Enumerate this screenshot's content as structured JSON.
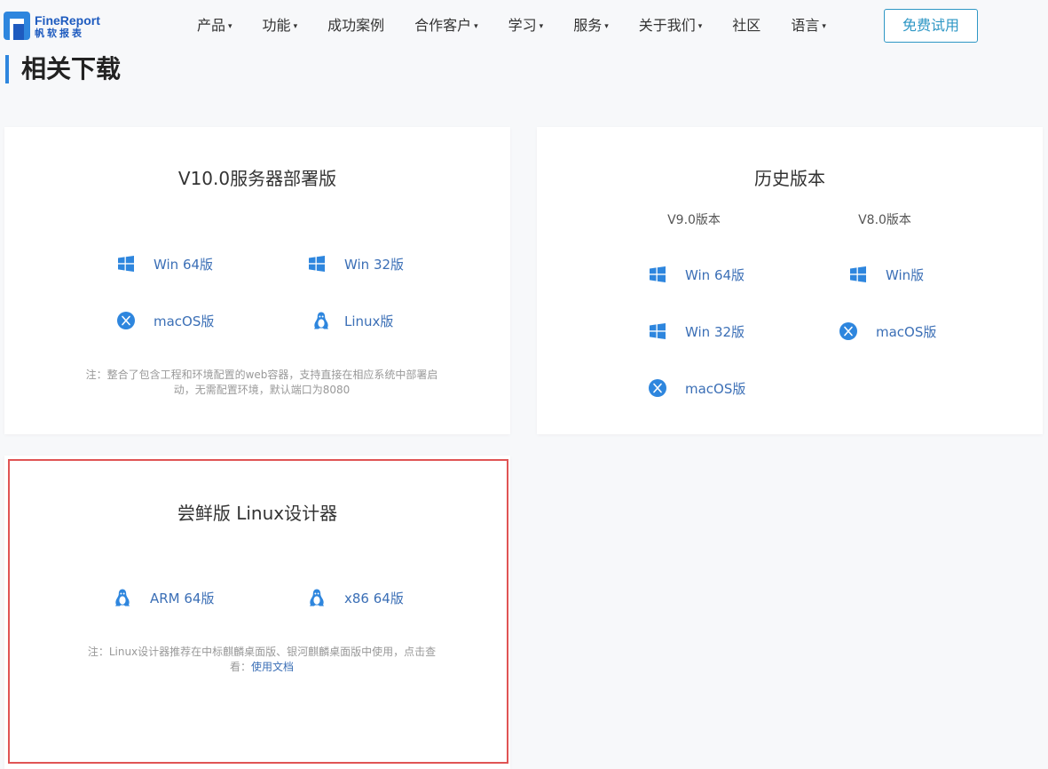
{
  "logo": {
    "en": "FineReport",
    "cn": "帆软报表"
  },
  "nav": {
    "items": [
      {
        "label": "产品",
        "caret": "▾"
      },
      {
        "label": "功能",
        "caret": "▾"
      },
      {
        "label": "成功案例",
        "caret": ""
      },
      {
        "label": "合作客户",
        "caret": "▾"
      },
      {
        "label": "学习",
        "caret": "▾"
      },
      {
        "label": "服务",
        "caret": "▾"
      },
      {
        "label": "关于我们",
        "caret": "▾"
      },
      {
        "label": "社区",
        "caret": ""
      },
      {
        "label": "语言",
        "caret": "▾"
      }
    ],
    "trial_label": "免费试用"
  },
  "section_title": "相关下载",
  "server_card": {
    "title": "V10.0服务器部署版",
    "links": [
      {
        "label": "Win 64版",
        "icon": "windows-icon"
      },
      {
        "label": "Win 32版",
        "icon": "windows-icon"
      },
      {
        "label": "macOS版",
        "icon": "macos-icon"
      },
      {
        "label": "Linux版",
        "icon": "linux-icon"
      }
    ],
    "note": "注：整合了包含工程和环境配置的web容器，支持直接在相应系统中部署启动，无需配置环境，默认端口为8080"
  },
  "history_card": {
    "title": "历史版本",
    "col1_head": "V9.0版本",
    "col2_head": "V8.0版本",
    "col1_links": [
      {
        "label": "Win 64版",
        "icon": "windows-icon"
      },
      {
        "label": "Win 32版",
        "icon": "windows-icon"
      },
      {
        "label": "macOS版",
        "icon": "macos-icon"
      }
    ],
    "col2_links": [
      {
        "label": "Win版",
        "icon": "windows-icon"
      },
      {
        "label": "macOS版",
        "icon": "macos-icon"
      }
    ]
  },
  "linux_card": {
    "title": "尝鲜版 Linux设计器",
    "links": [
      {
        "label": "ARM 64版",
        "icon": "linux-icon"
      },
      {
        "label": "x86 64版",
        "icon": "linux-icon"
      }
    ],
    "note_text": "注：Linux设计器推荐在中标麒麟桌面版、银河麒麟桌面版中使用，点击查看：",
    "note_link": "使用文档"
  },
  "colors": {
    "accent": "#2e86de",
    "link": "#3b6fb6",
    "trial_border": "#2e97c5",
    "highlight": "#e05454"
  }
}
